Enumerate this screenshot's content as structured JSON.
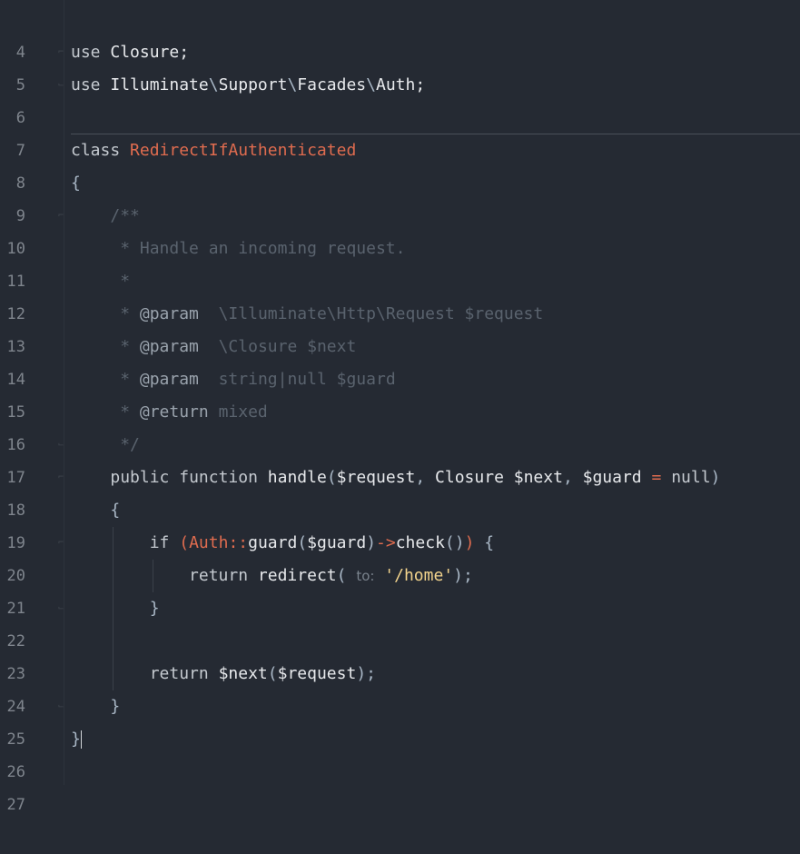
{
  "line_numbers": [
    "4",
    "5",
    "6",
    "7",
    "8",
    "9",
    "10",
    "11",
    "12",
    "13",
    "14",
    "15",
    "16",
    "17",
    "18",
    "19",
    "20",
    "21",
    "22",
    "23",
    "24",
    "25",
    "26",
    "27"
  ],
  "tokens": {
    "use": "use",
    "closure": "Closure",
    "semicolon": ";",
    "illuminate": "Illuminate",
    "backslash": "\\",
    "support": "Support",
    "facades": "Facades",
    "auth": "Auth",
    "class_kw": "class",
    "class_name": "RedirectIfAuthenticated",
    "open_brace": "{",
    "close_brace": "}",
    "doc_open": "/**",
    "doc_star": "*",
    "doc_handle": "Handle an incoming request.",
    "doc_close": "*/",
    "param_tag": "@param",
    "return_tag": "@return",
    "doc_request_type": "\\Illuminate\\Http\\Request $request",
    "doc_next_type": "\\Closure $next",
    "doc_guard_type": "string|null $guard",
    "doc_return_type": "mixed",
    "public_kw": "public",
    "function_kw": "function",
    "handle": "handle",
    "open_paren": "(",
    "close_paren": ")",
    "request_var": "$request",
    "comma": ",",
    "next_var": "$next",
    "guard_var": "$guard",
    "equals": "=",
    "null_kw": "null",
    "if_kw": "if",
    "double_colon": "::",
    "guard_fn": "guard",
    "arrow": "->",
    "check_fn": "check",
    "empty_parens": "()",
    "return_kw": "return",
    "redirect_fn": "redirect",
    "hint_to": "to:",
    "home_str": "'/home'",
    "close_paren_semi": ");"
  }
}
